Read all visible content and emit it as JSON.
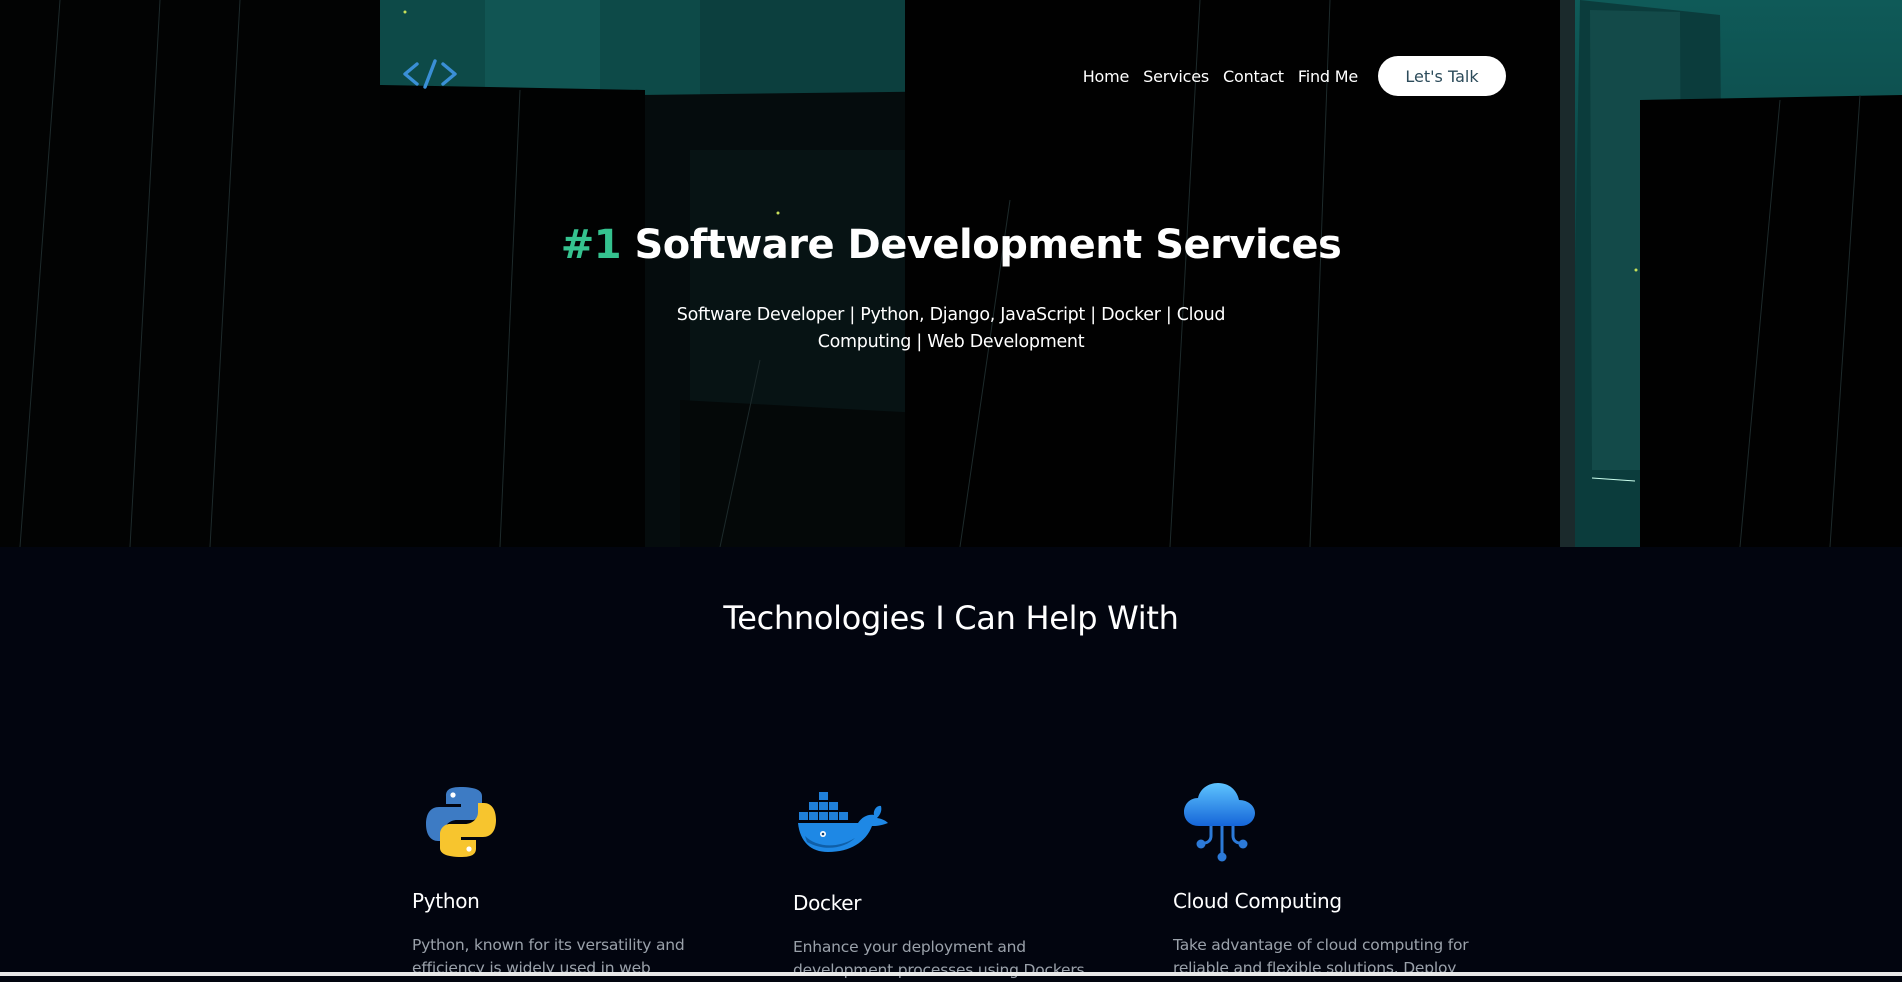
{
  "header": {
    "logo_icon": "code-brackets-icon",
    "nav": [
      {
        "label": "Home"
      },
      {
        "label": "Services"
      },
      {
        "label": "Contact"
      },
      {
        "label": "Find Me"
      }
    ],
    "cta_label": "Let's Talk"
  },
  "hero": {
    "title_number": "#1",
    "title_text": "Software Development Services",
    "subtitle": "Software Developer | Python, Django, JavaScript | Docker | Cloud Computing | Web Development"
  },
  "technologies": {
    "heading": "Technologies I Can Help With",
    "items": [
      {
        "name": "Python",
        "icon": "python-icon",
        "description": "Python, known for its versatility and efficiency is widely used in web"
      },
      {
        "name": "Docker",
        "icon": "docker-icon",
        "description": "Enhance your deployment and development processes using Dockers"
      },
      {
        "name": "Cloud Computing",
        "icon": "cloud-computing-icon",
        "description": "Take advantage of cloud computing for reliable and flexible solutions. Deploy"
      }
    ]
  },
  "colors": {
    "accent": "#35c28f",
    "background": "#02050f",
    "hero_teal": "#0a3f3f"
  }
}
